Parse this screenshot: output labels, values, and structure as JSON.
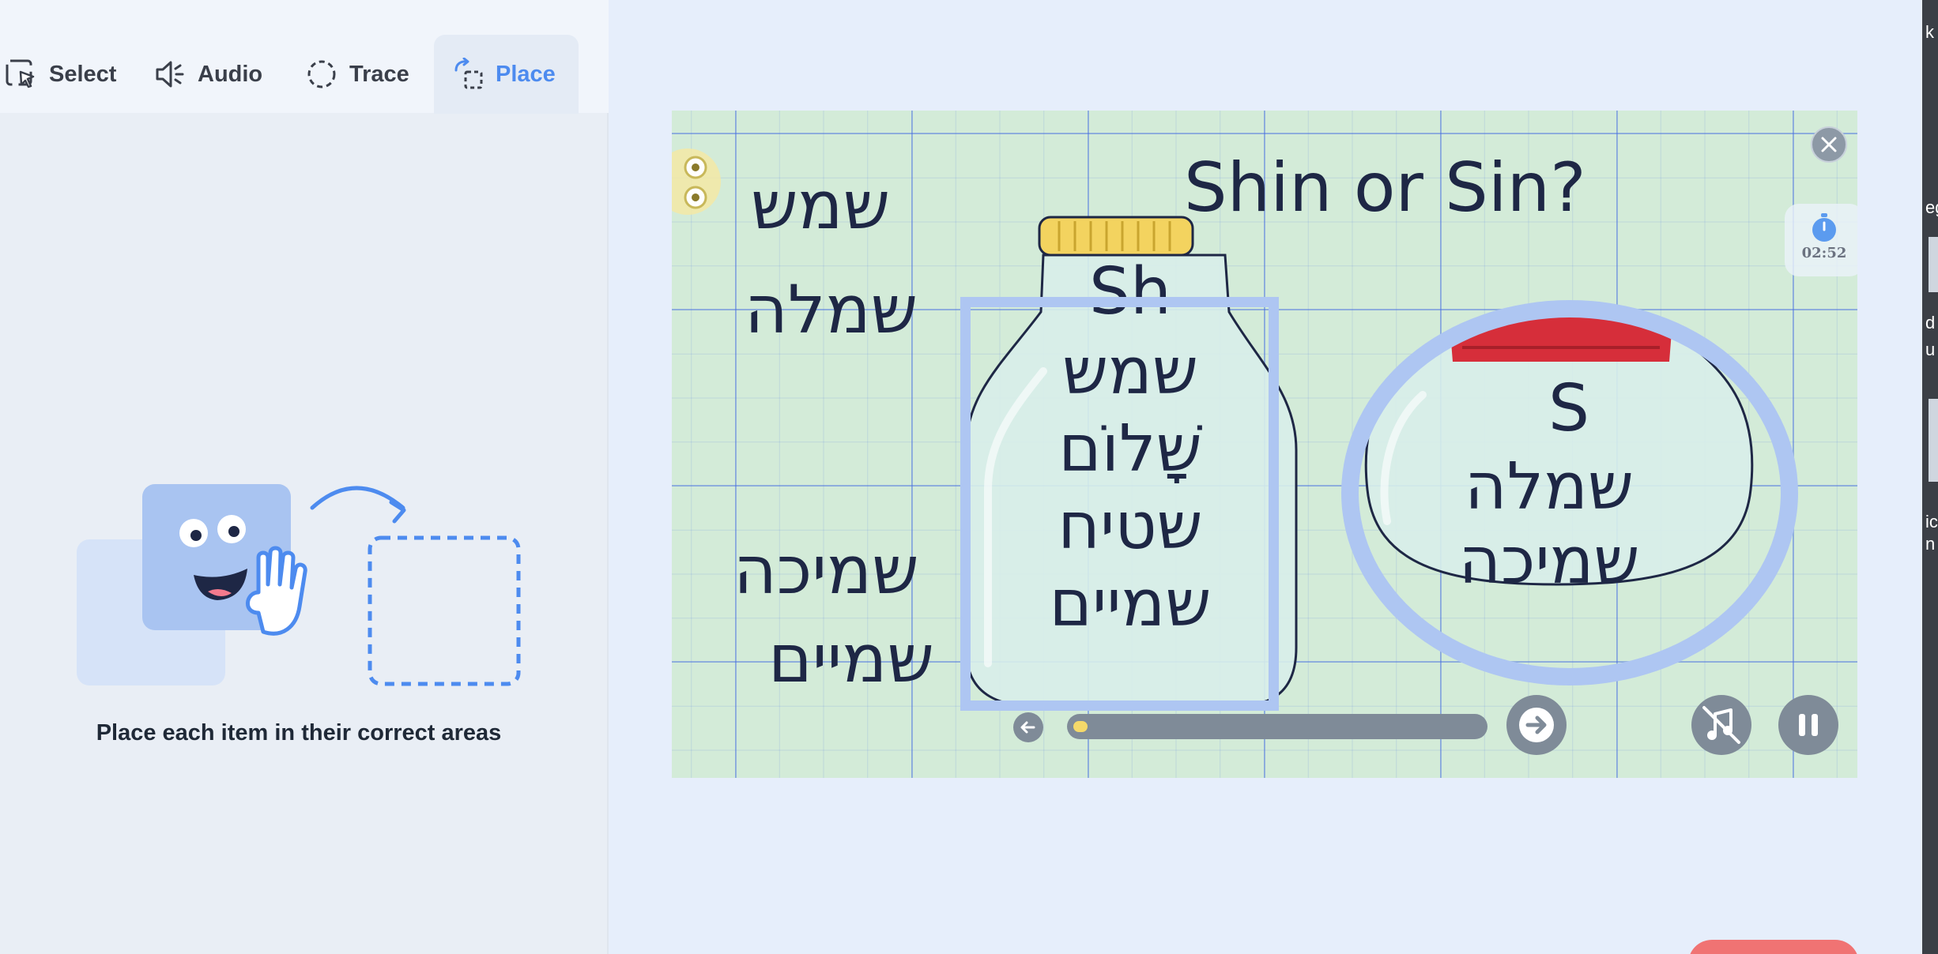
{
  "tabs": [
    {
      "label": "Select",
      "icon": "cursor-select-icon",
      "active": false
    },
    {
      "label": "Audio",
      "icon": "speaker-icon",
      "active": false
    },
    {
      "label": "Trace",
      "icon": "dashed-circle-icon",
      "active": false
    },
    {
      "label": "Place",
      "icon": "place-icon",
      "active": true
    }
  ],
  "panel": {
    "instruction": "Place each item in their correct areas"
  },
  "slide": {
    "title": "Shin or Sin?",
    "loose_words": [
      "שמש",
      "שמלה",
      "שמיכה",
      "שמיים"
    ],
    "jar_sh": {
      "label": "Sh",
      "words": [
        "שמש",
        "שָׁלוֹם",
        "שטיח",
        "שמיים"
      ]
    },
    "jar_s": {
      "label": "S",
      "words": [
        "שמלה",
        "שמיכה"
      ]
    },
    "timer": "02:52",
    "progress": 0.02
  },
  "colors": {
    "accent": "#4d8bef",
    "drop_zone": "#aec6f2",
    "slide_bg": "#d3ebd8",
    "text_dark": "#1e2745",
    "jar_lid_yellow": "#f3d35f",
    "jar_lid_red": "#d62e3a"
  }
}
